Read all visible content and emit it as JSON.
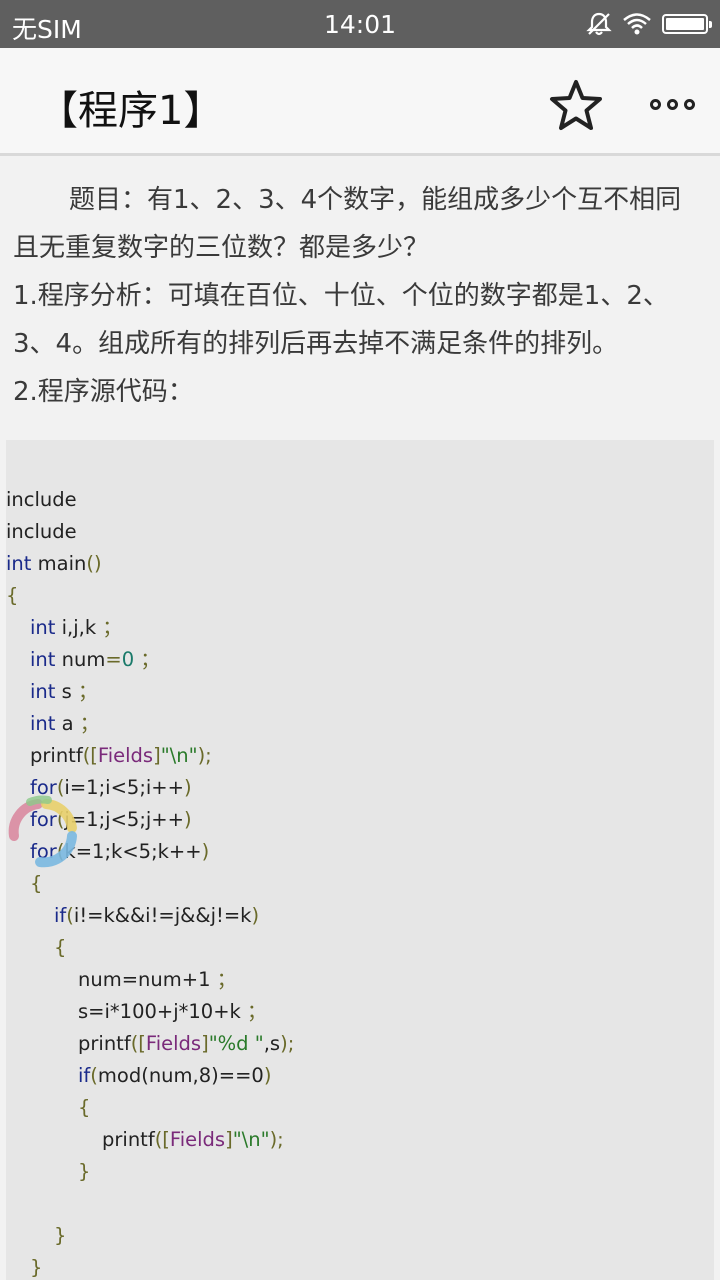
{
  "status_bar": {
    "carrier": "无SIM",
    "time": "14:01"
  },
  "app_bar": {
    "title": "【程序1】",
    "star_icon": "star-outline-icon",
    "more_icon": "more-horizontal-icon"
  },
  "description": {
    "question": "题目：有1、2、3、4个数字，能组成多少个互不相同且无重复数字的三位数？都是多少？",
    "analysis": "1.程序分析：可填在百位、十位、个位的数字都是1、2、3、4。组成所有的排列后再去掉不满足条件的排列。",
    "source_heading": "2.程序源代码："
  },
  "code": {
    "l1": "include",
    "l2": "include",
    "int": "int",
    "main": " main",
    "paren": "()",
    "brace_open": "{",
    "brace_close": "}",
    "decl_i": " i,j,k",
    "decl_num": " num",
    "eq": "=",
    "zero": "0",
    "decl_s": " s",
    "decl_a": " a",
    "semi": "；",
    "printf": "printf",
    "lp": "(",
    "rp": ")",
    "lb": "[",
    "fields": "Fields",
    "rb": "]",
    "newline_str": "\"\\n\"",
    "semi2": ");",
    "for": "for",
    "for1": "i=1;i<5;i++",
    "for2": "j=1;j<5;j++",
    "for3": "k=1;k<5;k++",
    "if": "if",
    "cond": "i!=k&&i!=j&&j!=k",
    "num_inc": "num=num+1",
    "calc": "s=i*100+j*10+k",
    "fmt_str": "\"%d \"",
    "comma_s": ",s",
    "mod_expr": "mod(num,8)==0"
  },
  "colors": {
    "keyword": "#1a2a8a",
    "number": "#1a7a6a",
    "string": "#2a7a2a",
    "field": "#7a2a7a",
    "operator": "#6a6a2a"
  }
}
